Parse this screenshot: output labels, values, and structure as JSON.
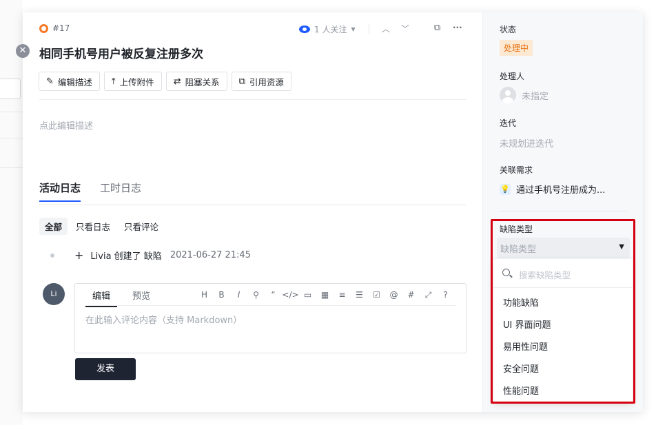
{
  "header": {
    "issue_id": "#17",
    "watchers_label": "1 人关注",
    "title": "相同手机号用户被反复注册多次"
  },
  "toolbar": {
    "edit_desc": "编辑描述",
    "upload": "上传附件",
    "blocking": "阻塞关系",
    "reference": "引用资源"
  },
  "description": {
    "placeholder": "点此编辑描述"
  },
  "tabs": {
    "activity": "活动日志",
    "worklog": "工时日志"
  },
  "filters": {
    "all": "全部",
    "logs_only": "只看日志",
    "comments_only": "只看评论"
  },
  "activity": {
    "text": "Livia 创建了 缺陷",
    "time": "2021-06-27 21:45"
  },
  "comment": {
    "avatar_initials": "Li",
    "tab_edit": "编辑",
    "tab_preview": "预览",
    "tools": [
      "H",
      "B",
      "I",
      "⚲",
      "“",
      "</>",
      "▭",
      "▦",
      "≡",
      "☰",
      "☑",
      "@",
      "#",
      "⤢",
      "?"
    ],
    "placeholder": "在此输入评论内容（支持 Markdown）",
    "submit": "发表"
  },
  "sidebar": {
    "status_label": "状态",
    "status_value": "处理中",
    "assignee_label": "处理人",
    "assignee_value": "未指定",
    "iteration_label": "迭代",
    "iteration_value": "未规划进迭代",
    "requirement_label": "关联需求",
    "requirement_value": "通过手机号注册成为...",
    "defect_type_label": "缺陷类型",
    "defect_type_placeholder": "缺陷类型",
    "search_placeholder": "搜索缺陷类型",
    "options": [
      "功能缺陷",
      "UI 界面问题",
      "易用性问题",
      "安全问题",
      "性能问题"
    ]
  },
  "colors": {
    "accent": "#1f5bff",
    "status_bg": "#fde8d2",
    "status_fg": "#e86f0c",
    "highlight": "#d4000f",
    "primary_button": "#1f2433"
  }
}
